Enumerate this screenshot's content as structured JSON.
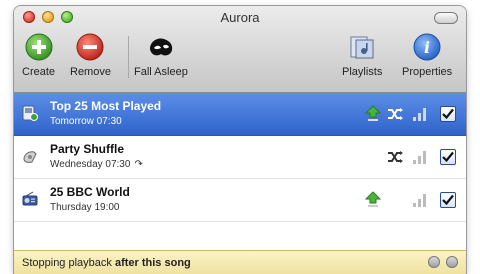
{
  "window": {
    "title": "Aurora"
  },
  "toolbar": {
    "create_label": "Create",
    "remove_label": "Remove",
    "sleep_label": "Fall Asleep",
    "playlists_label": "Playlists",
    "properties_label": "Properties"
  },
  "alarms": [
    {
      "name": "Top 25 Most Played",
      "when": "Tomorrow 07:30",
      "repeat": "",
      "selected": true,
      "icon": "playlist-icon",
      "shows_upload": true,
      "shows_shuffle": true
    },
    {
      "name": "Party Shuffle",
      "when": "Wednesday 07:30",
      "repeat": "↷",
      "selected": false,
      "icon": "party-shuffle-icon",
      "shows_upload": false,
      "shows_shuffle": true
    },
    {
      "name": "25 BBC World",
      "when": "Thursday 19:00",
      "repeat": "",
      "selected": false,
      "icon": "radio-icon",
      "shows_upload": true,
      "shows_shuffle": false
    }
  ],
  "status": {
    "text": "Stopping playback",
    "emphasis": "after this song"
  },
  "colors": {
    "selection": "#2f63c9",
    "status_bar": "#f3e9b2",
    "create": "#3fa02c",
    "remove": "#d32a1e",
    "properties": "#2f6fd0"
  }
}
